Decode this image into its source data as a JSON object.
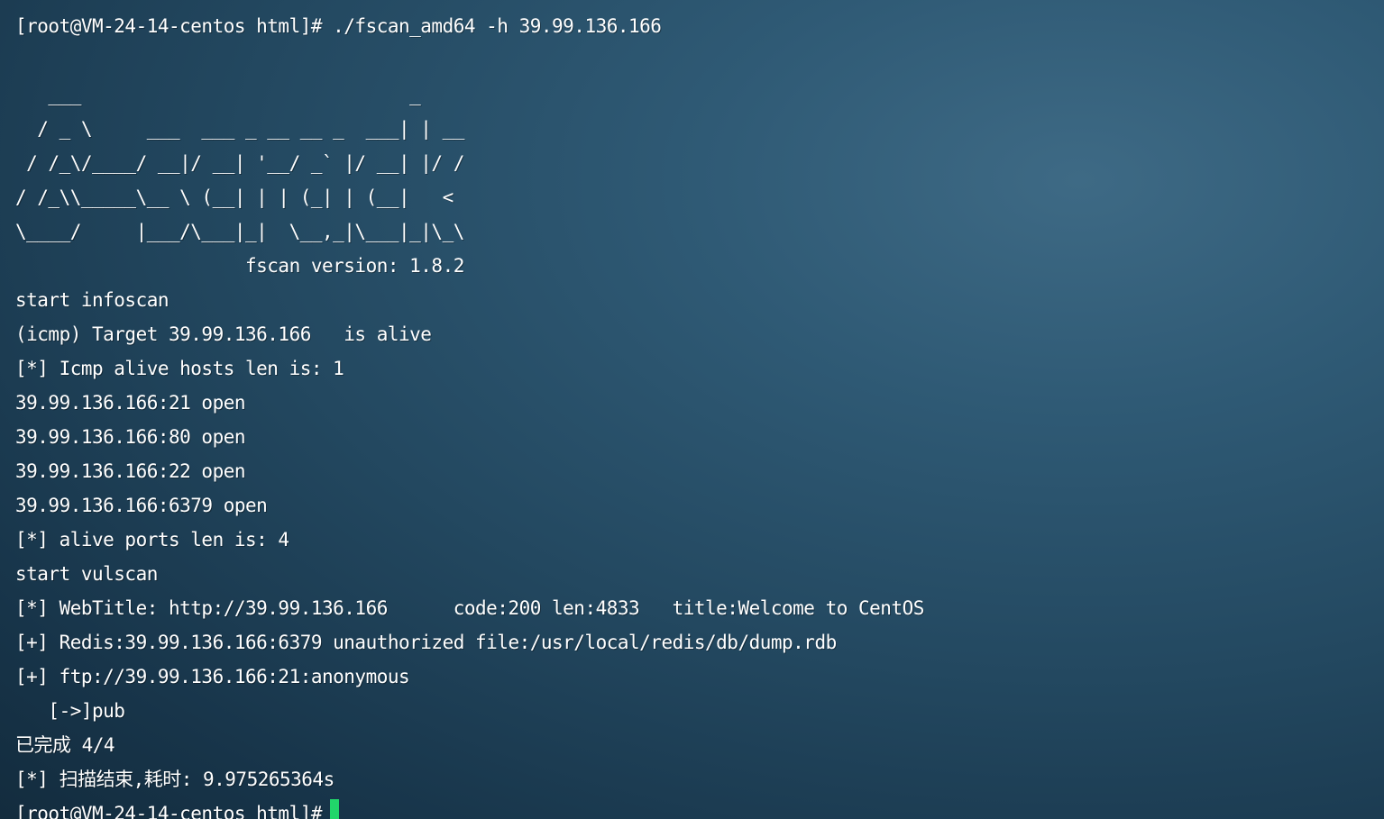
{
  "terminal": {
    "lines": [
      "[root@VM-24-14-centos html]# ./fscan_amd64 -h 39.99.136.166",
      "",
      "   ___                              _",
      "  / _ \\     ___  ___ _ __ __ _  ___| | __",
      " / /_\\/____/ __|/ __| '__/ _` |/ __| |/ /",
      "/ /_\\\\_____\\__ \\ (__| | | (_| | (__|   <",
      "\\____/     |___/\\___|_|  \\__,_|\\___|_|\\_\\",
      "                     fscan version: 1.8.2",
      "start infoscan",
      "(icmp) Target 39.99.136.166   is alive",
      "[*] Icmp alive hosts len is: 1",
      "39.99.136.166:21 open",
      "39.99.136.166:80 open",
      "39.99.136.166:22 open",
      "39.99.136.166:6379 open",
      "[*] alive ports len is: 4",
      "start vulscan",
      "[*] WebTitle: http://39.99.136.166      code:200 len:4833   title:Welcome to CentOS",
      "[+] Redis:39.99.136.166:6379 unauthorized file:/usr/local/redis/db/dump.rdb",
      "[+] ftp://39.99.136.166:21:anonymous",
      "   [->]pub",
      "已完成 4/4",
      "[*] 扫描结束,耗时: 9.975265364s",
      "[root@VM-24-14-centos html]# "
    ],
    "cursor_color": "#21d66a",
    "text_color": "#ffffff"
  }
}
